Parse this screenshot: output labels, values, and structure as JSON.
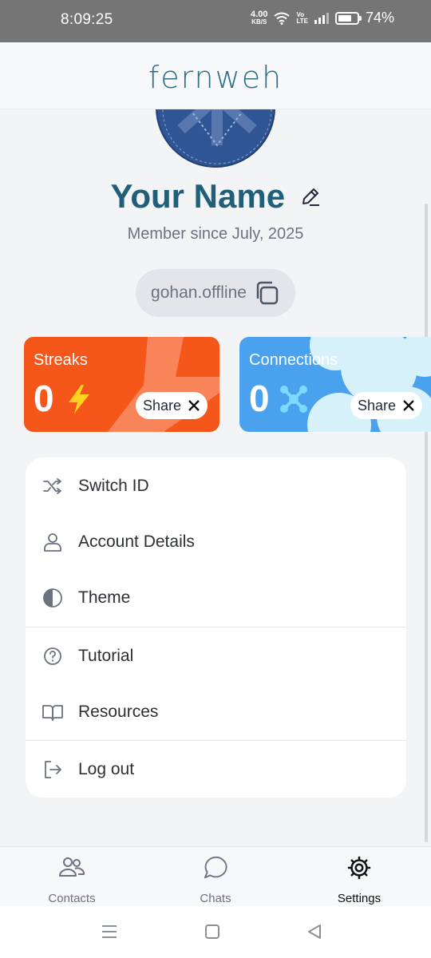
{
  "status_bar": {
    "time": "8:09:25",
    "net_speed_value": "4.00",
    "net_speed_unit": "KB/S",
    "volte_top": "Vo",
    "volte_bottom": "LTE",
    "battery_percent": "74%",
    "battery_level": 0.74,
    "icons": [
      "wifi-icon",
      "volte-icon",
      "signal-icon",
      "battery-icon"
    ]
  },
  "header": {
    "logo_text": "fernweh"
  },
  "profile": {
    "name": "Your Name",
    "member_since": "Member since July, 2025",
    "user_id": "gohan.offline"
  },
  "cards": {
    "streaks": {
      "title": "Streaks",
      "count": "0",
      "share_label": "Share",
      "share_icon": "x-logo-icon",
      "icon": "lightning-icon",
      "color": "#f5561a"
    },
    "connections": {
      "title": "Connections",
      "count": "0",
      "share_label": "Share",
      "share_icon": "x-logo-icon",
      "icon": "network-nodes-icon",
      "color": "#4aa2ef"
    }
  },
  "menu": {
    "items": [
      {
        "label": "Switch ID",
        "icon": "shuffle-icon"
      },
      {
        "label": "Account Details",
        "icon": "user-icon"
      },
      {
        "label": "Theme",
        "icon": "contrast-icon"
      },
      {
        "label": "Tutorial",
        "icon": "help-circle-icon"
      },
      {
        "label": "Resources",
        "icon": "book-open-icon"
      },
      {
        "label": "Log out",
        "icon": "log-out-icon"
      }
    ]
  },
  "bottom_nav": {
    "items": [
      {
        "label": "Contacts",
        "icon": "contacts-icon",
        "active": false
      },
      {
        "label": "Chats",
        "icon": "chat-bubble-icon",
        "active": false
      },
      {
        "label": "Settings",
        "icon": "settings-gear-icon",
        "active": true
      }
    ]
  },
  "colors": {
    "accent": "#1f5f7a",
    "logo": "#2a6f86",
    "streaks": "#f5561a",
    "connections": "#4aa2ef"
  }
}
